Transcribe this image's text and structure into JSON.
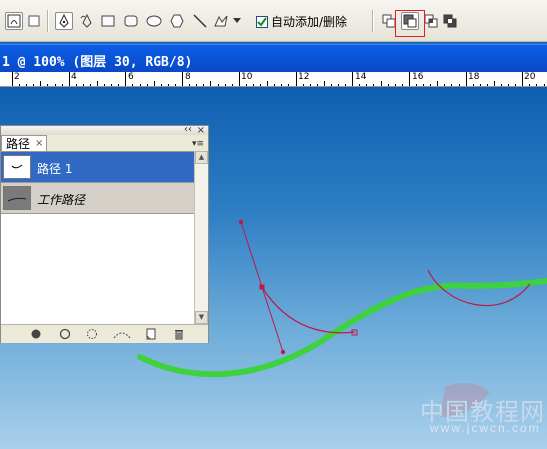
{
  "options_bar": {
    "auto_add_delete_label": "自动添加/删除",
    "auto_add_delete_checked": true,
    "tools": [
      "paths-mode-icon",
      "fill-pixels-icon",
      "pen-icon",
      "freeform-pen-icon",
      "rectangle-icon",
      "rounded-rectangle-icon",
      "ellipse-icon",
      "polygon-icon",
      "line-icon",
      "custom-shape-icon",
      "dropdown-arrow-icon"
    ],
    "path_ops": [
      "add-to-path-area-icon",
      "subtract-from-path-area-icon",
      "intersect-path-areas-icon",
      "exclude-overlapping-path-areas-icon"
    ]
  },
  "document": {
    "title": "1 @ 100% (图层 30, RGB/8)"
  },
  "ruler": {
    "labels": [
      "2",
      "4",
      "6",
      "8",
      "10",
      "12",
      "14",
      "16",
      "18",
      "20"
    ]
  },
  "paths_panel": {
    "tab_label": "路径",
    "tab_close": "×",
    "close_symbol": "×",
    "paths": [
      {
        "name": "路径 1",
        "selected": true
      },
      {
        "name": "工作路径",
        "selected": false
      }
    ],
    "footer_buttons": [
      "fill-path-icon",
      "stroke-path-icon",
      "load-as-selection-icon",
      "make-work-path-icon",
      "new-path-icon",
      "delete-path-icon"
    ]
  },
  "watermark": {
    "text": "中国教程网",
    "url": "www.jcwcn.com"
  },
  "colors": {
    "title_bar": "#0a48c8",
    "selected_row": "#316ac5",
    "green_stroke": "#3ed33e",
    "path_line": "#c0184a",
    "highlight_box": "#e02020"
  }
}
